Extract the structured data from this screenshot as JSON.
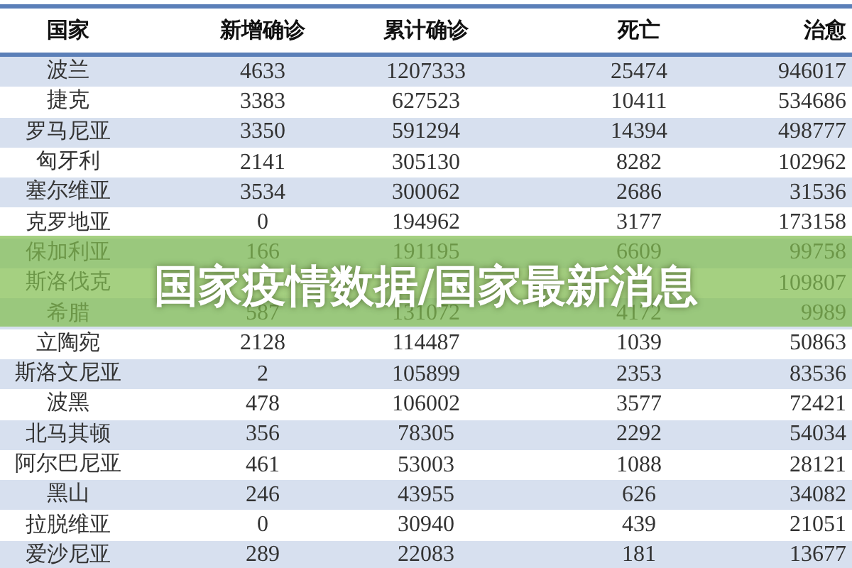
{
  "table": {
    "columns": [
      "国家",
      "新增确诊",
      "累计确诊",
      "死亡",
      "治愈"
    ],
    "rows": [
      {
        "country": "波兰",
        "new": "4633",
        "total": "1207333",
        "deaths": "25474",
        "recovered": "946017"
      },
      {
        "country": "捷克",
        "new": "3383",
        "total": "627523",
        "deaths": "10411",
        "recovered": "534686"
      },
      {
        "country": "罗马尼亚",
        "new": "3350",
        "total": "591294",
        "deaths": "14394",
        "recovered": "498777"
      },
      {
        "country": "匈牙利",
        "new": "2141",
        "total": "305130",
        "deaths": "8282",
        "recovered": "102962"
      },
      {
        "country": "塞尔维亚",
        "new": "3534",
        "total": "300062",
        "deaths": "2686",
        "recovered": "31536"
      },
      {
        "country": "克罗地亚",
        "new": "0",
        "total": "194962",
        "deaths": "3177",
        "recovered": "173158"
      },
      {
        "country": "保加利亚",
        "new": "166",
        "total": "191195",
        "deaths": "6609",
        "recovered": "99758"
      },
      {
        "country": "斯洛伐克",
        "recovered": "109807"
      },
      {
        "country": "希腊",
        "new": "587",
        "total": "131072",
        "deaths": "4172",
        "recovered": "9989"
      },
      {
        "country": "立陶宛",
        "new": "2128",
        "total": "114487",
        "deaths": "1039",
        "recovered": "50863"
      },
      {
        "country": "斯洛文尼亚",
        "new": "2",
        "total": "105899",
        "deaths": "2353",
        "recovered": "83536"
      },
      {
        "country": "波黑",
        "new": "478",
        "total": "106002",
        "deaths": "3577",
        "recovered": "72421"
      },
      {
        "country": "北马其顿",
        "new": "356",
        "total": "78305",
        "deaths": "2292",
        "recovered": "54034"
      },
      {
        "country": "阿尔巴尼亚",
        "new": "461",
        "total": "53003",
        "deaths": "1088",
        "recovered": "28121"
      },
      {
        "country": "黑山",
        "new": "246",
        "total": "43955",
        "deaths": "626",
        "recovered": "34082"
      },
      {
        "country": "拉脱维亚",
        "new": "0",
        "total": "30940",
        "deaths": "439",
        "recovered": "21051"
      },
      {
        "country": "爱沙尼亚",
        "new": "289",
        "total": "22083",
        "deaths": "181",
        "recovered": "13677"
      }
    ]
  },
  "banner": {
    "title": "国家疫情数据/国家最新消息"
  }
}
